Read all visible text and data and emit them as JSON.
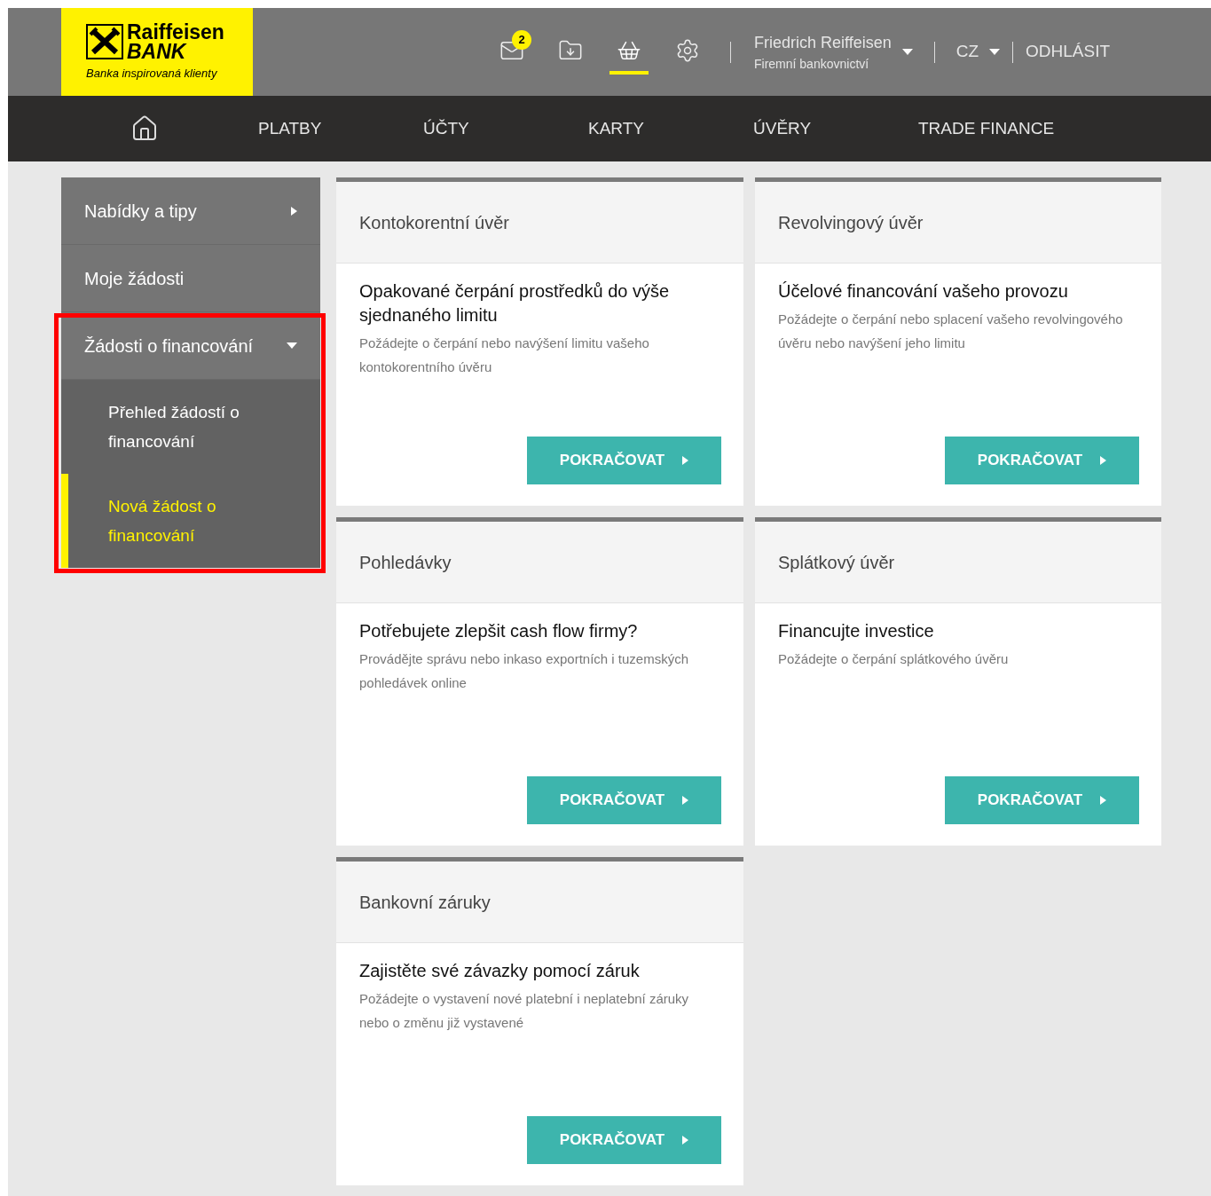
{
  "logo": {
    "name": "Raiffeisen",
    "bank": "BANK",
    "tagline": "Banka inspirovaná klienty"
  },
  "header_icons": [
    {
      "kind": "mail",
      "badge": "2",
      "selected": false
    },
    {
      "kind": "download",
      "selected": false
    },
    {
      "kind": "basket",
      "selected": true
    },
    {
      "kind": "settings",
      "selected": false
    }
  ],
  "user": {
    "name": "Friedrich Reiffeisen",
    "segment": "Firemní bankovnictví"
  },
  "language": "CZ",
  "logout": "ODHLÁSIT",
  "nav": [
    {
      "kind": "home"
    },
    {
      "kind": "text",
      "label": "PLATBY"
    },
    {
      "kind": "text",
      "label": "ÚČTY"
    },
    {
      "kind": "text",
      "label": "KARTY"
    },
    {
      "kind": "text",
      "label": "ÚVĚRY"
    },
    {
      "kind": "text",
      "label": "TRADE FINANCE"
    }
  ],
  "sidebar": {
    "items": [
      {
        "label": "Nabídky a tipy",
        "kind": "submenu",
        "expanded": false,
        "highlighted": false
      },
      {
        "label": "Moje žádosti",
        "kind": "link",
        "highlighted": false
      },
      {
        "label": "Žádosti o financování",
        "kind": "submenu",
        "expanded": true,
        "highlighted": true,
        "children": [
          {
            "label": "Přehled žádostí o financování",
            "selected": false
          },
          {
            "label": "Nová žádost o financování",
            "selected": true
          }
        ]
      }
    ]
  },
  "cards": [
    {
      "category": "Kontokorentní úvěr",
      "title": "Opakované čerpání prostředků do výše sjednaného limitu",
      "description": "Požádejte o čerpání nebo navýšení limitu vašeho kontokorentního úvěru",
      "button": "POKRAČOVAT"
    },
    {
      "category": "Revolvingový úvěr",
      "title": "Účelové financování vašeho provozu",
      "description": "Požádejte o čerpání nebo splacení vašeho revolvingového úvěru nebo navýšení jeho limitu",
      "button": "POKRAČOVAT"
    },
    {
      "category": "Pohledávky",
      "title": "Potřebujete zlepšit cash flow firmy?",
      "description": "Provádějte správu nebo inkaso exportních i tuzemských pohledávek online",
      "button": "POKRAČOVAT"
    },
    {
      "category": "Splátkový úvěr",
      "title": "Financujte investice",
      "description": "Požádejte o čerpání splátkového úvěru",
      "button": "POKRAČOVAT"
    },
    {
      "category": "Bankovní záruky",
      "title": "Zajistěte své závazky pomocí záruk",
      "description": "Požádejte o vystavení nové platební i neplatební záruky nebo o změnu již vystavené",
      "button": "POKRAČOVAT"
    }
  ]
}
